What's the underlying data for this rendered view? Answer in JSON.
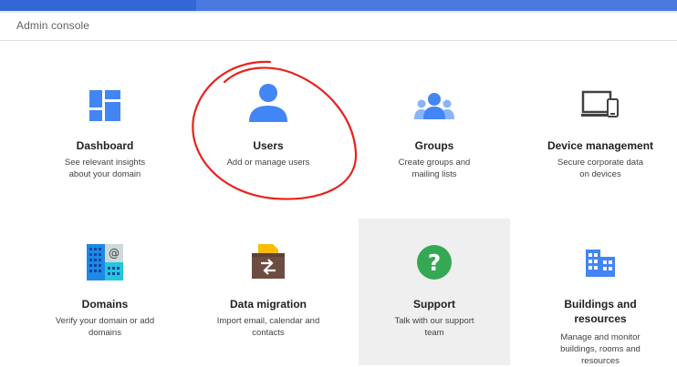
{
  "header": {
    "title": "Admin console"
  },
  "tiles": [
    {
      "title": "Dashboard",
      "desc": "See relevant insights about your domain",
      "icon": "dashboard-icon"
    },
    {
      "title": "Users",
      "desc": "Add or manage users",
      "icon": "user-icon"
    },
    {
      "title": "Groups",
      "desc": "Create groups and mailing lists",
      "icon": "groups-icon"
    },
    {
      "title": "Device management",
      "desc": "Secure corporate data on devices",
      "icon": "devices-icon"
    },
    {
      "title": "Domains",
      "desc": "Verify your domain or add domains",
      "icon": "domains-icon"
    },
    {
      "title": "Data migration",
      "desc": "Import email, calendar and contacts",
      "icon": "data-migration-icon"
    },
    {
      "title": "Support",
      "desc": "Talk with our support team",
      "icon": "support-icon"
    },
    {
      "title": "Buildings and resources",
      "desc": "Manage and monitor buildings, rooms and resources",
      "icon": "buildings-icon"
    }
  ],
  "colors": {
    "blue": "#4285f4",
    "green": "#34a853",
    "yellow": "#fbbc04",
    "brown": "#795548",
    "annotation_red": "#e8231d",
    "header_blue": "#3367d6"
  }
}
